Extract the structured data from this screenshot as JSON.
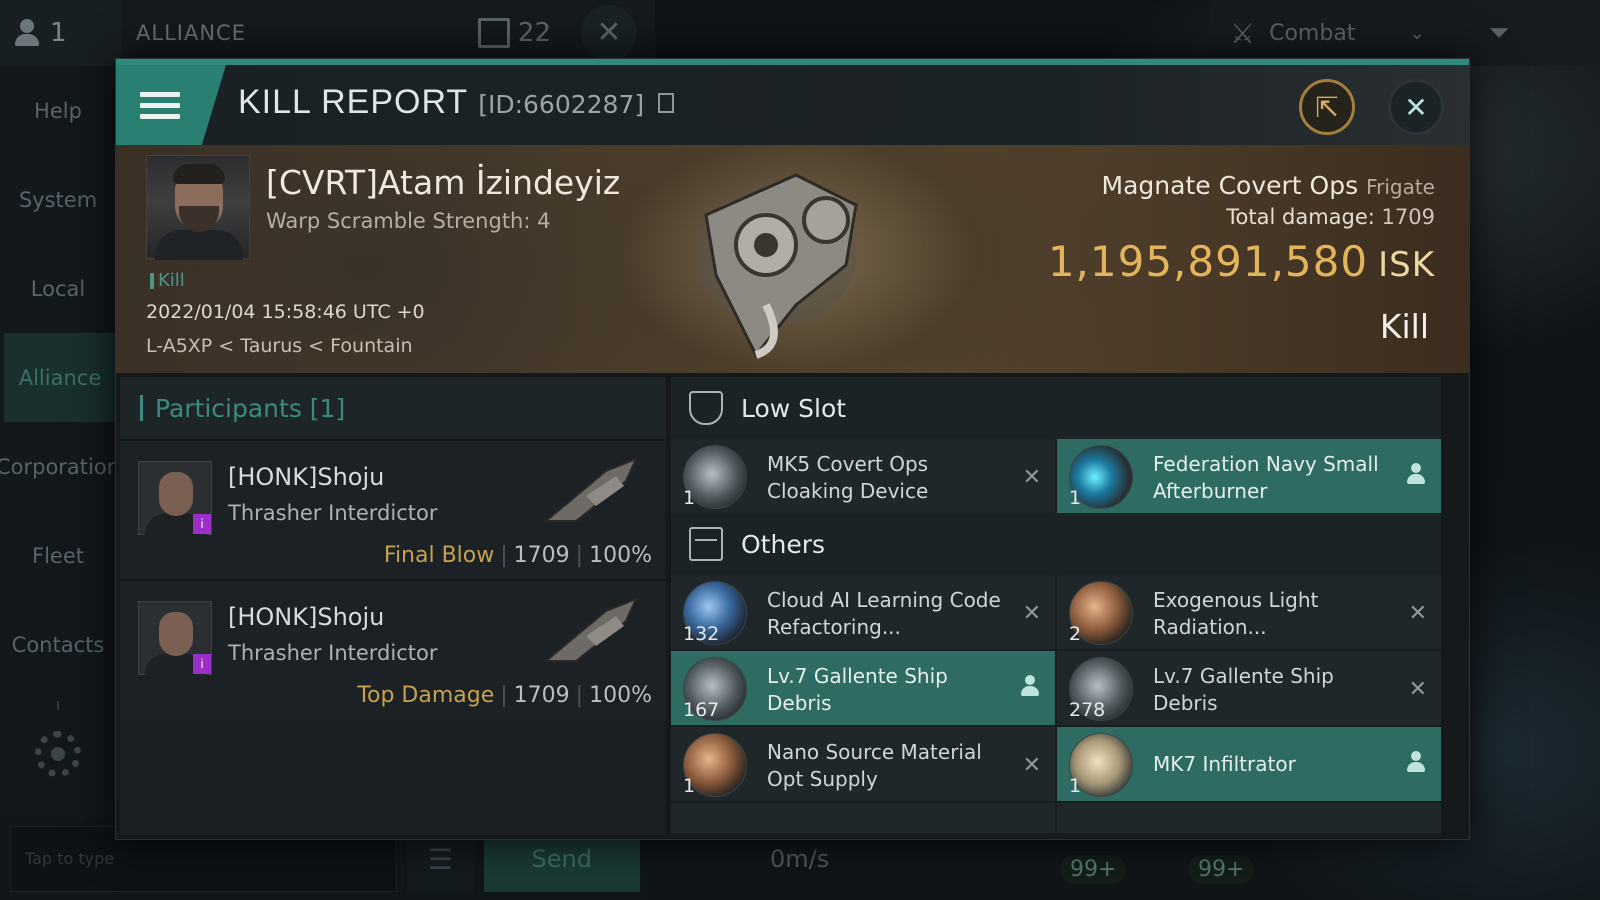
{
  "background": {
    "user_count": "1",
    "alliance_title": "ALLIANCE",
    "message_count": "22",
    "combat_label": "Combat",
    "sidebar": [
      "Help",
      "System",
      "Local",
      "Alliance",
      "Corporation",
      "Fleet",
      "Contacts"
    ],
    "sidebar_active": "Alliance",
    "chat_placeholder": "Tap to type",
    "send_label": "Send",
    "speed": "0m/s",
    "badge_a": "99+",
    "badge_b": "99+"
  },
  "header": {
    "title": "KILL REPORT",
    "id": "[ID:6602287]",
    "accent_color": "#2f8a7d"
  },
  "victim": {
    "name": "[CVRT]Atam İzindeyiz",
    "warp_scramble": "Warp Scramble Strength: 4",
    "kill_tag": "Kill",
    "datetime": "2022/01/04 15:58:46 UTC +0",
    "location": "L-A5XP < Taurus < Fountain",
    "ship_name": "Magnate Covert Ops",
    "ship_class": "Frigate",
    "total_damage_label": "Total damage:",
    "total_damage": "1709",
    "isk_value": "1,195,891,580",
    "isk_unit": "ISK",
    "result": "Kill"
  },
  "participants": {
    "title": "Participants [1]",
    "rows": [
      {
        "name": "[HONK]Shoju",
        "ship": "Thrasher Interdictor",
        "label": "Final Blow",
        "damage": "1709",
        "percent": "100%"
      },
      {
        "name": "[HONK]Shoju",
        "ship": "Thrasher Interdictor",
        "label": "Top Damage",
        "damage": "1709",
        "percent": "100%"
      }
    ]
  },
  "low_slot": {
    "title": "Low Slot",
    "items": [
      {
        "qty": "1",
        "name": "MK5 Covert Ops Cloaking Device",
        "state": "destroyed",
        "icon": "cloak-icon"
      },
      {
        "qty": "1",
        "name": "Federation Navy Small Afterburner",
        "state": "dropped",
        "icon": "afterburner-icon"
      }
    ]
  },
  "others": {
    "title": "Others",
    "items": [
      {
        "qty": "132",
        "name": "Cloud AI Learning Code Refactoring...",
        "state": "destroyed",
        "icon": "sphere-icon"
      },
      {
        "qty": "2",
        "name": "Exogenous Light Radiation...",
        "state": "destroyed",
        "icon": "radiation-icon"
      },
      {
        "qty": "167",
        "name": "Lv.7 Gallente Ship Debris",
        "state": "dropped",
        "icon": "debris-icon"
      },
      {
        "qty": "278",
        "name": "Lv.7 Gallente Ship Debris",
        "state": "destroyed",
        "icon": "debris-icon"
      },
      {
        "qty": "1",
        "name": "Nano Source Material Opt Supply",
        "state": "destroyed",
        "icon": "nano-icon"
      },
      {
        "qty": "1",
        "name": "MK7 Infiltrator",
        "state": "dropped",
        "icon": "drone-icon"
      }
    ]
  }
}
